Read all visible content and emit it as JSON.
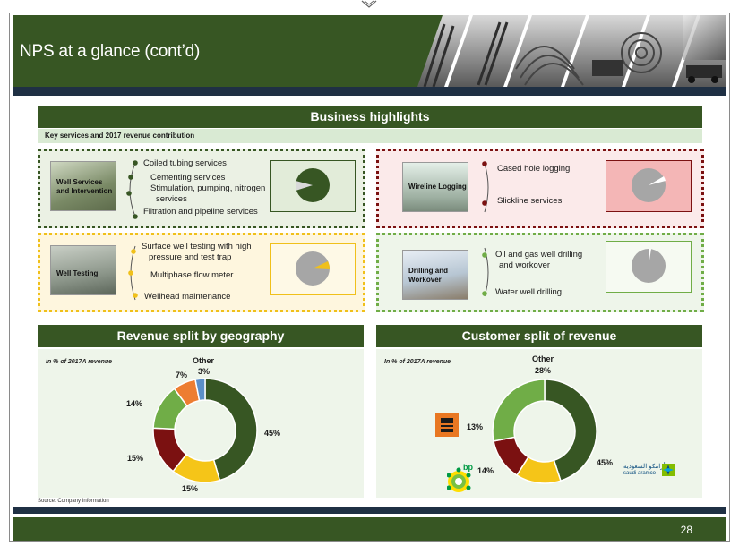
{
  "header": {
    "title": "NPS at a glance (cont’d)"
  },
  "business": {
    "title": "Business highlights",
    "subtitle": "Key services and 2017 revenue contribution",
    "quadrants": [
      {
        "name": "Well Services and Intervention",
        "items": [
          "Coiled tubing services",
          "Cementing services",
          "Stimulation, pumping, nitrogen",
          "services",
          "Filtration and pipeline services"
        ]
      },
      {
        "name": "Wireline Logging",
        "items": [
          "Cased hole logging",
          "Slickline services"
        ]
      },
      {
        "name": "Well Testing",
        "items": [
          "Surface well testing with high",
          "pressure and test trap",
          "Multiphase flow meter",
          "Wellhead maintenance"
        ]
      },
      {
        "name": "Drilling and Workover",
        "items": [
          "Oil and gas well drilling",
          "and workover",
          "Water well drilling"
        ]
      }
    ],
    "colors": {
      "dark_green": "#375623",
      "dark_red": "#7b1111",
      "yellow": "#f0c01a",
      "light_green": "#70ad47",
      "grey": "#a6a6a6"
    }
  },
  "geography": {
    "title": "Revenue split by geography",
    "note": "In % of 2017A revenue",
    "other_label": "Other"
  },
  "customer": {
    "title": "Customer split of revenue",
    "note": "In % of 2017A revenue",
    "other_label": "Other"
  },
  "chart_data": [
    {
      "type": "pie",
      "title": "Revenue split by geography",
      "labels": [
        "",
        "",
        "",
        "",
        "",
        "Other"
      ],
      "values": [
        45,
        15,
        15,
        14,
        7,
        3
      ],
      "value_labels": [
        "45%",
        "15%",
        "15%",
        "14%",
        "7%",
        "3%"
      ],
      "colors": [
        "#375623",
        "#f5c518",
        "#7b1111",
        "#70ad47",
        "#ed7d31",
        "#5b8fc9"
      ]
    },
    {
      "type": "pie",
      "title": "Customer split of revenue",
      "labels": [
        "",
        "",
        "",
        "Other"
      ],
      "values": [
        45,
        14,
        13,
        28
      ],
      "value_labels": [
        "45%",
        "14%",
        "13%",
        "28%"
      ],
      "colors": [
        "#375623",
        "#f5c518",
        "#7b1111",
        "#70ad47"
      ]
    }
  ],
  "logos": {
    "bp_text": "bp",
    "aramco_text": "أرامكو السعودية",
    "aramco_sub": "saudi aramco"
  },
  "source": "Source: Company  Information",
  "footer": {
    "page_number": "28"
  }
}
